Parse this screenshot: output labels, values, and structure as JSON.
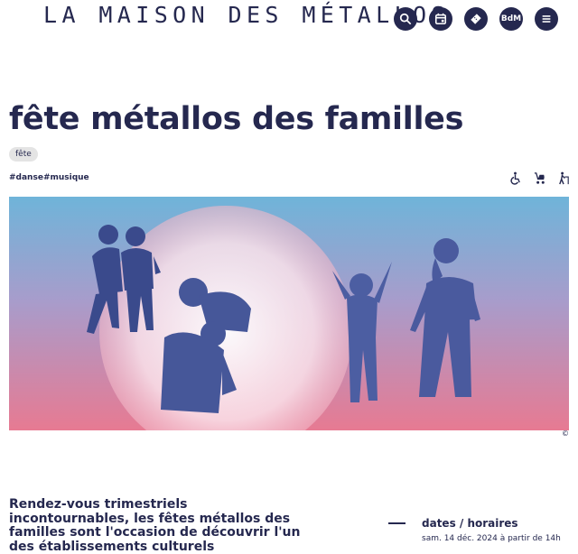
{
  "header": {
    "logo_text": "LA MAISON DES MÉTALLOS",
    "nav": [
      {
        "icon": "search-icon"
      },
      {
        "icon": "calendar-icon"
      },
      {
        "icon": "ticket-icon"
      },
      {
        "icon": "bdm-icon",
        "label": "BdM"
      },
      {
        "icon": "menu-icon"
      }
    ]
  },
  "event": {
    "title": "fête métallos des familles",
    "category": "fête",
    "tags": [
      "#danse",
      "#musique"
    ],
    "accessibility": [
      "wheelchair-icon",
      "stroller-icon",
      "walking-cane-icon"
    ],
    "image_credit": "©"
  },
  "intro": {
    "text": "Rendez-vous trimestriels incontournables, les fêtes métallos des familles sont l'occasion de découvrir l'un des établissements culturels"
  },
  "dates": {
    "heading": "dates / horaires",
    "first_line": "sam. 14 déc. 2024 à partir de 14h"
  },
  "colors": {
    "navy": "#25284f",
    "gradient_top": "#6fb4d9",
    "gradient_bottom": "#e77a92"
  }
}
